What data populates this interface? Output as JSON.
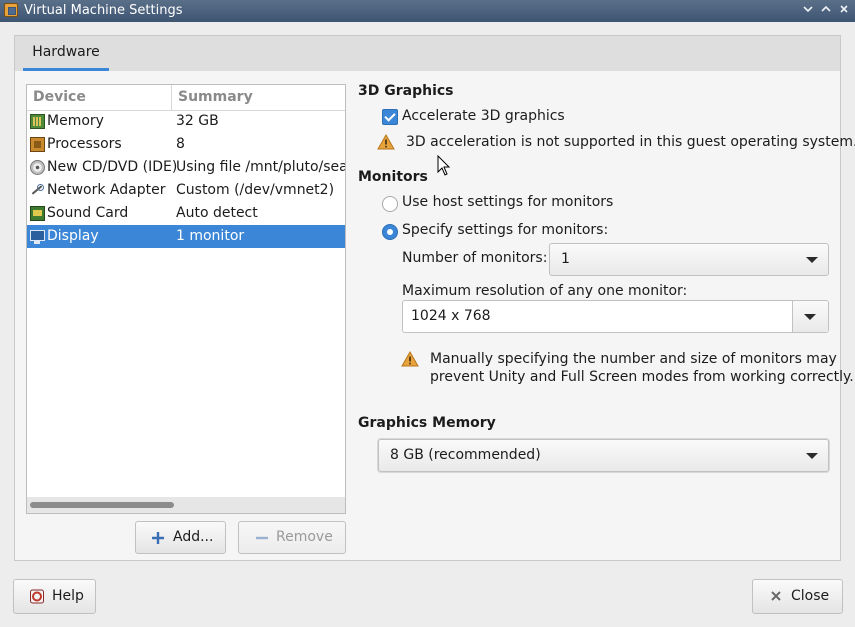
{
  "window": {
    "title": "Virtual Machine Settings"
  },
  "tabs": [
    {
      "label": "Hardware",
      "active": true
    }
  ],
  "device_table": {
    "columns": [
      "Device",
      "Summary"
    ],
    "rows": [
      {
        "icon": "memory-icon",
        "device": "Memory",
        "summary": "32 GB"
      },
      {
        "icon": "processor-icon",
        "device": "Processors",
        "summary": "8"
      },
      {
        "icon": "cd-dvd-icon",
        "device": "New CD/DVD (IDE)",
        "summary": "Using file /mnt/pluto/seaga"
      },
      {
        "icon": "network-adapter-icon",
        "device": "Network Adapter",
        "summary": "Custom (/dev/vmnet2)"
      },
      {
        "icon": "sound-card-icon",
        "device": "Sound Card",
        "summary": "Auto detect"
      },
      {
        "icon": "display-icon",
        "device": "Display",
        "summary": "1 monitor",
        "selected": true
      }
    ]
  },
  "buttons": {
    "add": "Add...",
    "remove": "Remove",
    "help": "Help",
    "close": "Close"
  },
  "graphics3d": {
    "title": "3D Graphics",
    "accelerate_label": "Accelerate 3D graphics",
    "accelerate_checked": true,
    "warning": "3D acceleration is not supported in this guest operating system."
  },
  "monitors": {
    "title": "Monitors",
    "option_host": "Use host settings for monitors",
    "option_specify": "Specify settings for monitors:",
    "selected_option": "specify",
    "count_label": "Number of monitors:",
    "count_value": "1",
    "resolution_label": "Maximum resolution of any one monitor:",
    "resolution_value": "1024 x 768",
    "warning_line1": "Manually specifying the number and size of monitors may",
    "warning_line2": "prevent Unity and Full Screen modes from working correctly."
  },
  "graphics_memory": {
    "title": "Graphics Memory",
    "value": "8 GB (recommended)"
  },
  "colors": {
    "accent": "#3b86d6",
    "titlebar": "#4a6180",
    "warning": "#e8a33c"
  }
}
